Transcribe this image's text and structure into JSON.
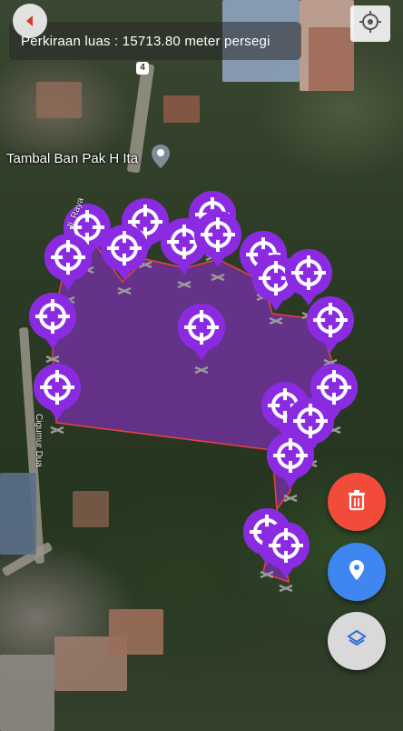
{
  "header": {
    "area_text": "Perkiraan luas : 15713.80 meter persegi"
  },
  "map": {
    "place_label": "Tambal Ban Pak H Ita",
    "road_label_1": "Jl. Raya",
    "road_label_2": "Cigumur Dua",
    "route_number": "4"
  },
  "colors": {
    "polygon_fill": "#7b2fb0",
    "polygon_stroke": "#e8443a",
    "marker": "#8a2be2",
    "delete_fab": "#f24b3a",
    "location_fab": "#3f86f0",
    "layers_fab": "#d9d9d9"
  },
  "icons": {
    "back": "back-arrow-icon",
    "locate": "crosshair-gps-icon",
    "delete": "trash-icon",
    "location": "location-pin-icon",
    "layers": "layers-icon",
    "marker": "crosshair-marker-icon"
  }
}
